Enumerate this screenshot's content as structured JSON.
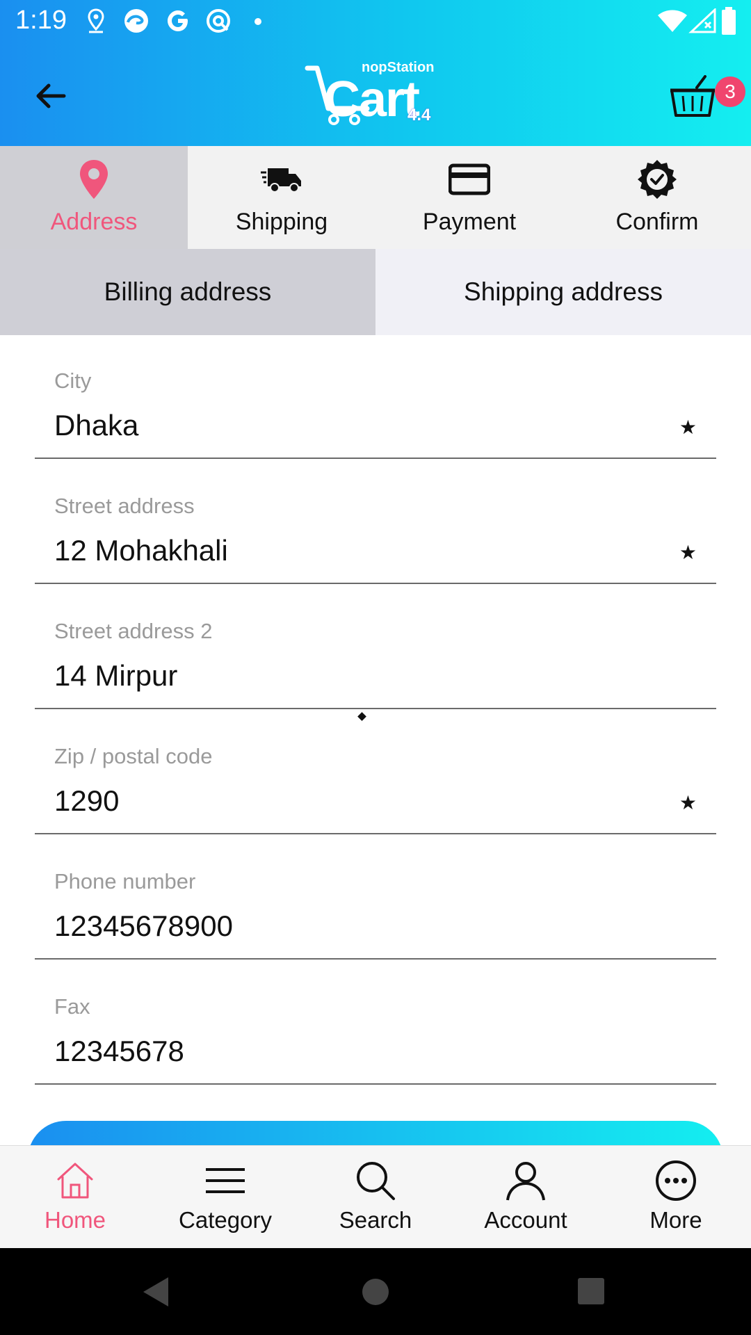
{
  "status_bar": {
    "time": "1:19",
    "icons": [
      "location-icon",
      "edge-icon",
      "google-icon",
      "assistant-icon",
      "notification-dot",
      "wifi-icon",
      "signal-icon",
      "battery-icon"
    ]
  },
  "app_bar": {
    "logo": {
      "brand_small": "nopStation",
      "brand_big": "Cart",
      "version": "4.4"
    },
    "cart_badge": "3"
  },
  "steps": [
    {
      "label": "Address",
      "icon": "location-pin-icon",
      "active": true
    },
    {
      "label": "Shipping",
      "icon": "truck-icon",
      "active": false
    },
    {
      "label": "Payment",
      "icon": "credit-card-icon",
      "active": false
    },
    {
      "label": "Confirm",
      "icon": "check-badge-icon",
      "active": false
    }
  ],
  "address_tabs": {
    "billing": "Billing address",
    "shipping": "Shipping address",
    "selected": "billing"
  },
  "form": {
    "city": {
      "label": "City",
      "value": "Dhaka",
      "required": true
    },
    "street": {
      "label": "Street address",
      "value": "12 Mohakhali",
      "required": true
    },
    "street2": {
      "label": "Street address 2",
      "value": "14 Mirpur",
      "required": false
    },
    "zip": {
      "label": "Zip / postal code",
      "value": "1290",
      "required": true
    },
    "phone": {
      "label": "Phone number",
      "value": "12345678900",
      "required": false
    },
    "fax": {
      "label": "Fax",
      "value": "12345678",
      "required": false
    },
    "required_mark": "★"
  },
  "bottom_nav": [
    {
      "label": "Home",
      "icon": "home-icon",
      "active": true
    },
    {
      "label": "Category",
      "icon": "menu-lines-icon",
      "active": false
    },
    {
      "label": "Search",
      "icon": "search-icon",
      "active": false
    },
    {
      "label": "Account",
      "icon": "person-icon",
      "active": false
    },
    {
      "label": "More",
      "icon": "more-dots-icon",
      "active": false
    }
  ],
  "colors": {
    "accent": "#f0567c",
    "gradient_start": "#1a8ff0",
    "gradient_end": "#14eef0"
  }
}
